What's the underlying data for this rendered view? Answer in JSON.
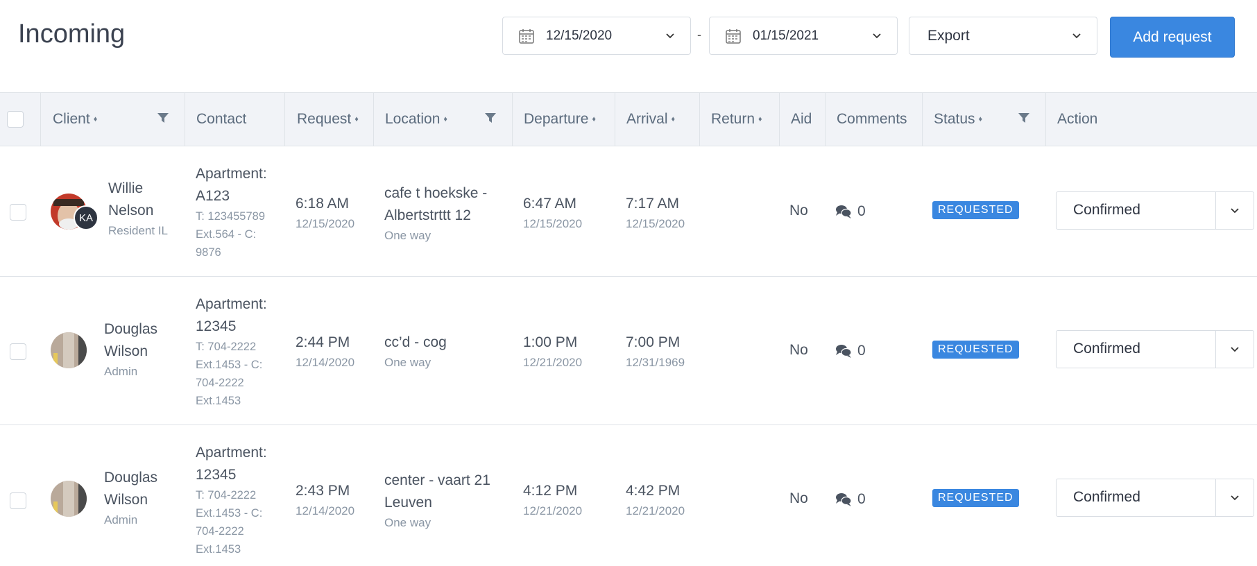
{
  "page_title": "Incoming",
  "filters": {
    "date_from": "12/15/2020",
    "date_separator": "-",
    "date_to": "01/15/2021",
    "export_label": "Export",
    "add_request_label": "Add request"
  },
  "table": {
    "columns": [
      "Client",
      "Contact",
      "Request",
      "Location",
      "Departure",
      "Arrival",
      "Return",
      "Aid",
      "Comments",
      "Status",
      "Action"
    ],
    "rows": [
      {
        "client_name_1": "Willie",
        "client_name_2": "Nelson",
        "client_role": "Resident IL",
        "badge": "KA",
        "contact_apt_1": "Apartment:",
        "contact_apt_2": "A123",
        "contact_lines": [
          "T: 123455789",
          "Ext.564 - C:",
          "9876"
        ],
        "request_time": "6:18 AM",
        "request_date": "12/15/2020",
        "location_1": "cafe t hoekske -",
        "location_2": "Albertstrttt 12",
        "trip_type": "One way",
        "departure_time": "6:47 AM",
        "departure_date": "12/15/2020",
        "arrival_time": "7:17 AM",
        "arrival_date": "12/15/2020",
        "aid": "No",
        "comments": "0",
        "status": "REQUESTED",
        "action": "Confirmed"
      },
      {
        "client_name_1": "Douglas",
        "client_name_2": "Wilson",
        "client_role": "Admin",
        "contact_apt_1": "Apartment:",
        "contact_apt_2": "12345",
        "contact_lines": [
          "T: 704-2222",
          "Ext.1453 - C:",
          "704-2222",
          "Ext.1453"
        ],
        "request_time": "2:44 PM",
        "request_date": "12/14/2020",
        "location_1": "cc’d - cog",
        "location_2": "",
        "trip_type": "One way",
        "departure_time": "1:00 PM",
        "departure_date": "12/21/2020",
        "arrival_time": "7:00 PM",
        "arrival_date": "12/31/1969",
        "aid": "No",
        "comments": "0",
        "status": "REQUESTED",
        "action": "Confirmed"
      },
      {
        "client_name_1": "Douglas",
        "client_name_2": "Wilson",
        "client_role": "Admin",
        "contact_apt_1": "Apartment:",
        "contact_apt_2": "12345",
        "contact_lines": [
          "T: 704-2222",
          "Ext.1453 - C:",
          "704-2222",
          "Ext.1453"
        ],
        "request_time": "2:43 PM",
        "request_date": "12/14/2020",
        "location_1": "center - vaart 21",
        "location_2": "Leuven",
        "trip_type": "One way",
        "departure_time": "4:12 PM",
        "departure_date": "12/21/2020",
        "arrival_time": "4:42 PM",
        "arrival_date": "12/21/2020",
        "aid": "No",
        "comments": "0",
        "status": "REQUESTED",
        "action": "Confirmed"
      }
    ]
  },
  "colors": {
    "accent": "#3a87e0",
    "header_bg": "#f1f3f7",
    "border": "#dfe3e8"
  },
  "icons": {
    "calendar": "calendar-icon",
    "chevron": "chevron-down-icon",
    "filter": "filter-icon",
    "comment": "comment-icon"
  }
}
